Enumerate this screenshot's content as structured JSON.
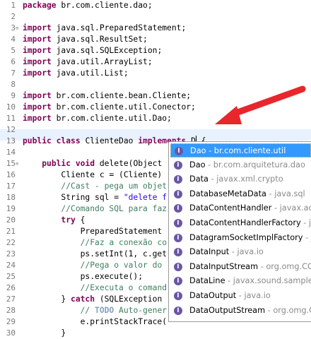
{
  "editor": {
    "lines": [
      {
        "num": "1",
        "segs": [
          {
            "t": "package",
            "c": "kw"
          },
          {
            "t": " br.com.cliente.dao;"
          }
        ]
      },
      {
        "num": "2",
        "segs": []
      },
      {
        "num": "3",
        "fold": "⊖",
        "segs": [
          {
            "t": "import",
            "c": "kw"
          },
          {
            "t": " java.sql.PreparedStatement;"
          }
        ]
      },
      {
        "num": "4",
        "segs": [
          {
            "t": "import",
            "c": "kw"
          },
          {
            "t": " java.sql.ResultSet;"
          }
        ]
      },
      {
        "num": "5",
        "segs": [
          {
            "t": "import",
            "c": "kw"
          },
          {
            "t": " java.sql.SQLException;"
          }
        ]
      },
      {
        "num": "6",
        "segs": [
          {
            "t": "import",
            "c": "kw"
          },
          {
            "t": " java.util.ArrayList;"
          }
        ]
      },
      {
        "num": "7",
        "segs": [
          {
            "t": "import",
            "c": "kw"
          },
          {
            "t": " java.util.List;"
          }
        ]
      },
      {
        "num": "8",
        "segs": []
      },
      {
        "num": "9",
        "segs": [
          {
            "t": "import",
            "c": "kw"
          },
          {
            "t": " br.com.cliente.bean.Cliente;"
          }
        ]
      },
      {
        "num": "10",
        "segs": [
          {
            "t": "import",
            "c": "kw"
          },
          {
            "t": " br.com.cliente.util.Conector;"
          }
        ]
      },
      {
        "num": "11",
        "segs": [
          {
            "t": "import",
            "c": "kw"
          },
          {
            "t": " br.com.cliente.util.Dao;"
          }
        ]
      },
      {
        "num": "12",
        "segs": []
      },
      {
        "num": "13",
        "segs": [
          {
            "t": "public",
            "c": "kw"
          },
          {
            "t": " "
          },
          {
            "t": "class",
            "c": "kw"
          },
          {
            "t": " ClienteDao "
          },
          {
            "t": "implements",
            "c": "kw"
          },
          {
            "t": " D"
          },
          {
            "t": "|",
            "c": "caret"
          },
          {
            "t": " {"
          }
        ]
      },
      {
        "num": "14",
        "segs": []
      },
      {
        "num": "15",
        "fold": "⊖",
        "segs": [
          {
            "t": "    "
          },
          {
            "t": "public",
            "c": "kw"
          },
          {
            "t": " "
          },
          {
            "t": "void",
            "c": "kw"
          },
          {
            "t": " delete(Object"
          }
        ]
      },
      {
        "num": "16",
        "segs": [
          {
            "t": "        Cliente c = (Cliente)"
          }
        ]
      },
      {
        "num": "17",
        "segs": [
          {
            "t": "        "
          },
          {
            "t": "//Cast - pega um objet",
            "c": "cm"
          }
        ]
      },
      {
        "num": "18",
        "segs": [
          {
            "t": "        String sql = "
          },
          {
            "t": "\"delete f",
            "c": "str"
          }
        ]
      },
      {
        "num": "19",
        "segs": [
          {
            "t": "        "
          },
          {
            "t": "//Comando SQL para faz",
            "c": "cm"
          }
        ]
      },
      {
        "num": "20",
        "segs": [
          {
            "t": "        "
          },
          {
            "t": "try",
            "c": "kw"
          },
          {
            "t": " {"
          }
        ]
      },
      {
        "num": "21",
        "segs": [
          {
            "t": "            PreparedStatement"
          }
        ]
      },
      {
        "num": "22",
        "segs": [
          {
            "t": "            "
          },
          {
            "t": "//Faz a conexão co",
            "c": "cm"
          }
        ]
      },
      {
        "num": "23",
        "segs": [
          {
            "t": "            ps.setInt(1, c.get"
          }
        ]
      },
      {
        "num": "24",
        "segs": [
          {
            "t": "            "
          },
          {
            "t": "//Pega o valor do",
            "c": "cm"
          }
        ]
      },
      {
        "num": "25",
        "segs": [
          {
            "t": "            ps.execute();"
          }
        ]
      },
      {
        "num": "26",
        "segs": [
          {
            "t": "            "
          },
          {
            "t": "//Executa o comand",
            "c": "cm"
          }
        ]
      },
      {
        "num": "27",
        "segs": [
          {
            "t": "        } "
          },
          {
            "t": "catch",
            "c": "kw"
          },
          {
            "t": " (SQLException"
          }
        ]
      },
      {
        "num": "28",
        "segs": [
          {
            "t": "            "
          },
          {
            "t": "// ",
            "c": "cm"
          },
          {
            "t": "TODO",
            "c": "tag"
          },
          {
            "t": " Auto-gener",
            "c": "cm"
          }
        ]
      },
      {
        "num": "29",
        "segs": [
          {
            "t": "            e.printStackTrace("
          }
        ]
      },
      {
        "num": "30",
        "segs": [
          {
            "t": "        }"
          }
        ]
      }
    ]
  },
  "annotation": {
    "arrow_color": "#e8262b"
  },
  "autocomplete": {
    "icon_letter": "I",
    "icon_color": "#6b56a6",
    "items": [
      {
        "name": "Dao",
        "pkg": " - br.com.cliente.util",
        "selected": true
      },
      {
        "name": "Dao",
        "pkg": " - br.com.arquitetura.dao"
      },
      {
        "name": "Data",
        "pkg": " - javax.xml.crypto"
      },
      {
        "name": "DatabaseMetaData",
        "pkg": " - java.sql"
      },
      {
        "name": "DataContentHandler",
        "pkg": " - javax.activ"
      },
      {
        "name": "DataContentHandlerFactory",
        "pkg": " - jav"
      },
      {
        "name": "DatagramSocketImplFactory",
        "pkg": " - jav"
      },
      {
        "name": "DataInput",
        "pkg": " - java.io"
      },
      {
        "name": "DataInputStream",
        "pkg": " - org.omg.COR"
      },
      {
        "name": "DataLine",
        "pkg": " - javax.sound.sampled"
      },
      {
        "name": "DataOutput",
        "pkg": " - java.io"
      },
      {
        "name": "DataOutputStream",
        "pkg": " - org.omg.CO"
      }
    ]
  }
}
